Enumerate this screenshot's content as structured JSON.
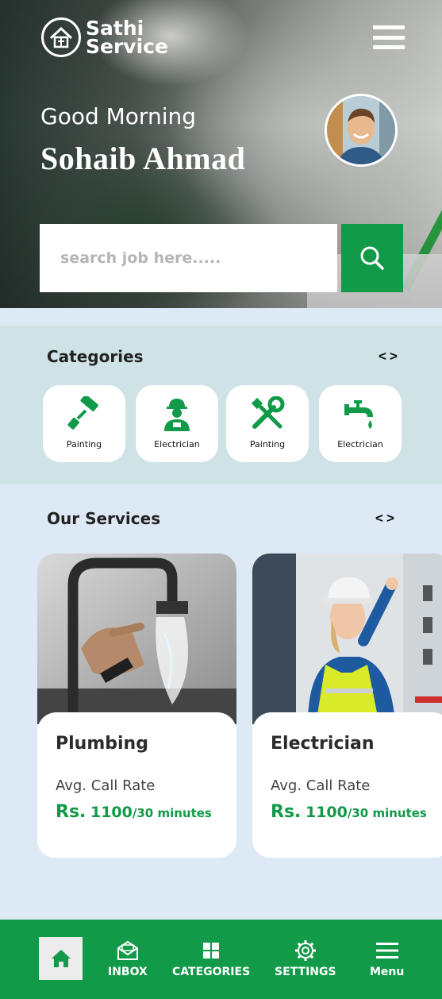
{
  "brand": {
    "line1": "Sathi",
    "line2": "Service"
  },
  "header": {
    "greeting": "Good Morning",
    "user_name": "Sohaib Ahmad"
  },
  "search": {
    "placeholder": "search job here....."
  },
  "categories": {
    "title": "Categories",
    "prev": "<",
    "next": ">",
    "items": [
      {
        "label": "Painting",
        "icon": "paint-roller-icon"
      },
      {
        "label": "Electrician",
        "icon": "electrician-worker-icon"
      },
      {
        "label": "Painting",
        "icon": "wrench-screwdriver-icon"
      },
      {
        "label": "Electrician",
        "icon": "water-tap-icon"
      }
    ]
  },
  "services": {
    "title": "Our Services",
    "prev": "<",
    "next": ">",
    "items": [
      {
        "name": "Plumbing",
        "rate_label": "Avg. Call Rate",
        "currency": "Rs.",
        "amount": "1100",
        "per": "/30 minutes"
      },
      {
        "name": "Electrician",
        "rate_label": "Avg. Call Rate",
        "currency": "Rs.",
        "amount": "1100",
        "per": "/30 minutes"
      }
    ]
  },
  "bottom_nav": {
    "items": [
      {
        "label": "",
        "icon": "home-icon"
      },
      {
        "label": "INBOX",
        "icon": "envelope-icon"
      },
      {
        "label": "CATEGORIES",
        "icon": "grid-icon"
      },
      {
        "label": "SETTINGS",
        "icon": "gear-icon"
      },
      {
        "label": "Menu",
        "icon": "hamburger-icon"
      }
    ]
  },
  "colors": {
    "brand_green": "#119a48",
    "category_bg": "#cfe3e7",
    "page_bg": "#dde9f4"
  }
}
